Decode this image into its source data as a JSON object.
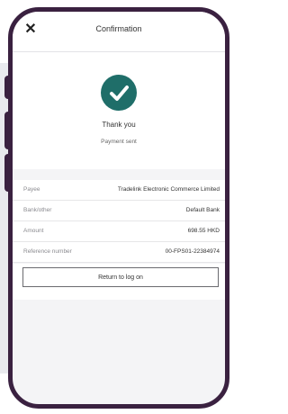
{
  "header": {
    "title": "Confirmation",
    "close_icon": "close-icon"
  },
  "status": {
    "icon": "checkmark-circle-icon",
    "accent_color": "#1f6e69",
    "heading": "Thank you",
    "message": "Payment sent"
  },
  "details": [
    {
      "label": "Payee",
      "value": "Tradelink Electronic Commerce Limited"
    },
    {
      "label": "Bank/other",
      "value": "Default Bank"
    },
    {
      "label": "Amount",
      "value": "698.55 HKD"
    },
    {
      "label": "Reference number",
      "value": "00-FPS01-22384974"
    }
  ],
  "actions": {
    "return_label": "Return to log on"
  },
  "device": {
    "frame_color": "#3a2140"
  }
}
